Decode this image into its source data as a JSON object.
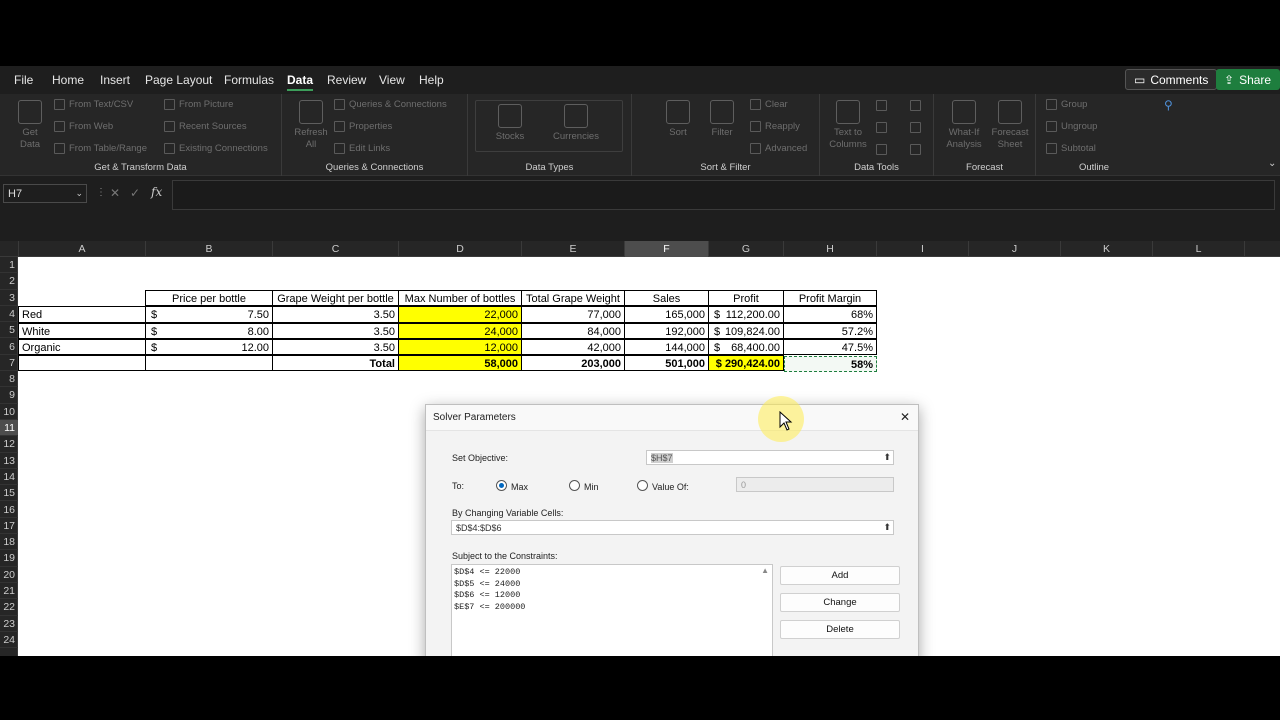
{
  "menu": {
    "tabs": [
      "File",
      "Home",
      "Insert",
      "Page Layout",
      "Formulas",
      "Data",
      "Review",
      "View",
      "Help"
    ],
    "active_tab": "Data",
    "comments_label": "Comments",
    "share_label": "Share",
    "accent_color": "#1e7e3e"
  },
  "ribbon": {
    "get_transform": {
      "get_data_label": "Get Data",
      "from_text_csv": "From Text/CSV",
      "from_web": "From Web",
      "from_table_range": "From Table/Range",
      "from_picture": "From Picture",
      "recent_sources": "Recent Sources",
      "existing_connections": "Existing Connections",
      "group_label": "Get & Transform Data"
    },
    "queries": {
      "refresh_all": "Refresh All",
      "queries_connections": "Queries & Connections",
      "properties": "Properties",
      "edit_links": "Edit Links",
      "group_label": "Queries & Connections"
    },
    "data_types": {
      "stocks": "Stocks",
      "currencies": "Currencies",
      "group_label": "Data Types"
    },
    "sort_filter": {
      "sort": "Sort",
      "filter": "Filter",
      "clear": "Clear",
      "reapply": "Reapply",
      "advanced": "Advanced",
      "group_label": "Sort & Filter"
    },
    "data_tools": {
      "text_to_columns": "Text to Columns",
      "group_label": "Data Tools"
    },
    "forecast": {
      "what_if": "What-If Analysis",
      "forecast_sheet": "Forecast Sheet",
      "group_label": "Forecast"
    },
    "outline": {
      "group": "Group",
      "ungroup": "Ungroup",
      "subtotal": "Subtotal",
      "group_label": "Outline"
    }
  },
  "formula_bar": {
    "name_box": "H7",
    "fx": "fx",
    "content": ""
  },
  "sheet": {
    "columns": [
      "A",
      "B",
      "C",
      "D",
      "E",
      "F",
      "G",
      "H",
      "I",
      "J",
      "K",
      "L"
    ],
    "selected_column": "F",
    "rows": [
      "1",
      "2",
      "3",
      "4",
      "5",
      "6",
      "7",
      "8",
      "9",
      "10",
      "11",
      "12",
      "13",
      "14",
      "15",
      "16",
      "17",
      "18",
      "19",
      "20",
      "21",
      "22",
      "23",
      "24"
    ],
    "selected_row": "11",
    "headers": [
      "Price per bottle",
      "Grape Weight per bottle",
      "Max Number of bottles",
      "Total Grape Weight",
      "Sales",
      "Profit",
      "Profit Margin"
    ],
    "data_rows": [
      {
        "name": "Red",
        "price_sym": "$",
        "price": "7.50",
        "weight": "3.50",
        "max": "22,000",
        "total_weight": "77,000",
        "sales": "165,000",
        "profit_sym": "$",
        "profit": "112,200.00",
        "margin": "68%"
      },
      {
        "name": "White",
        "price_sym": "$",
        "price": "8.00",
        "weight": "3.50",
        "max": "24,000",
        "total_weight": "84,000",
        "sales": "192,000",
        "profit_sym": "$",
        "profit": "109,824.00",
        "margin": "57.2%"
      },
      {
        "name": "Organic",
        "price_sym": "$",
        "price": "12.00",
        "weight": "3.50",
        "max": "12,000",
        "total_weight": "42,000",
        "sales": "144,000",
        "profit_sym": "$",
        "profit": "68,400.00",
        "margin": "47.5%"
      }
    ],
    "total": {
      "label": "Total",
      "max": "58,000",
      "total_weight": "203,000",
      "sales": "501,000",
      "profit": "$ 290,424.00",
      "margin": "58%"
    },
    "highlight_color": "#ffff00"
  },
  "solver": {
    "title": "Solver Parameters",
    "set_objective_label": "Set Objective:",
    "objective": "$H$7",
    "to_label": "To:",
    "max_label": "Max",
    "min_label": "Min",
    "value_of_label": "Value Of:",
    "value_of": "0",
    "selected": "Max",
    "changing_label": "By Changing Variable Cells:",
    "changing": "$D$4:$D$6",
    "constraints_label": "Subject to the Constraints:",
    "constraints": [
      "$D$4 <= 22000",
      "$D$5 <= 24000",
      "$D$6 <= 12000",
      "$E$7 <= 200000"
    ],
    "add_label": "Add",
    "change_label": "Change",
    "delete_label": "Delete",
    "close_glyph": "✕"
  }
}
